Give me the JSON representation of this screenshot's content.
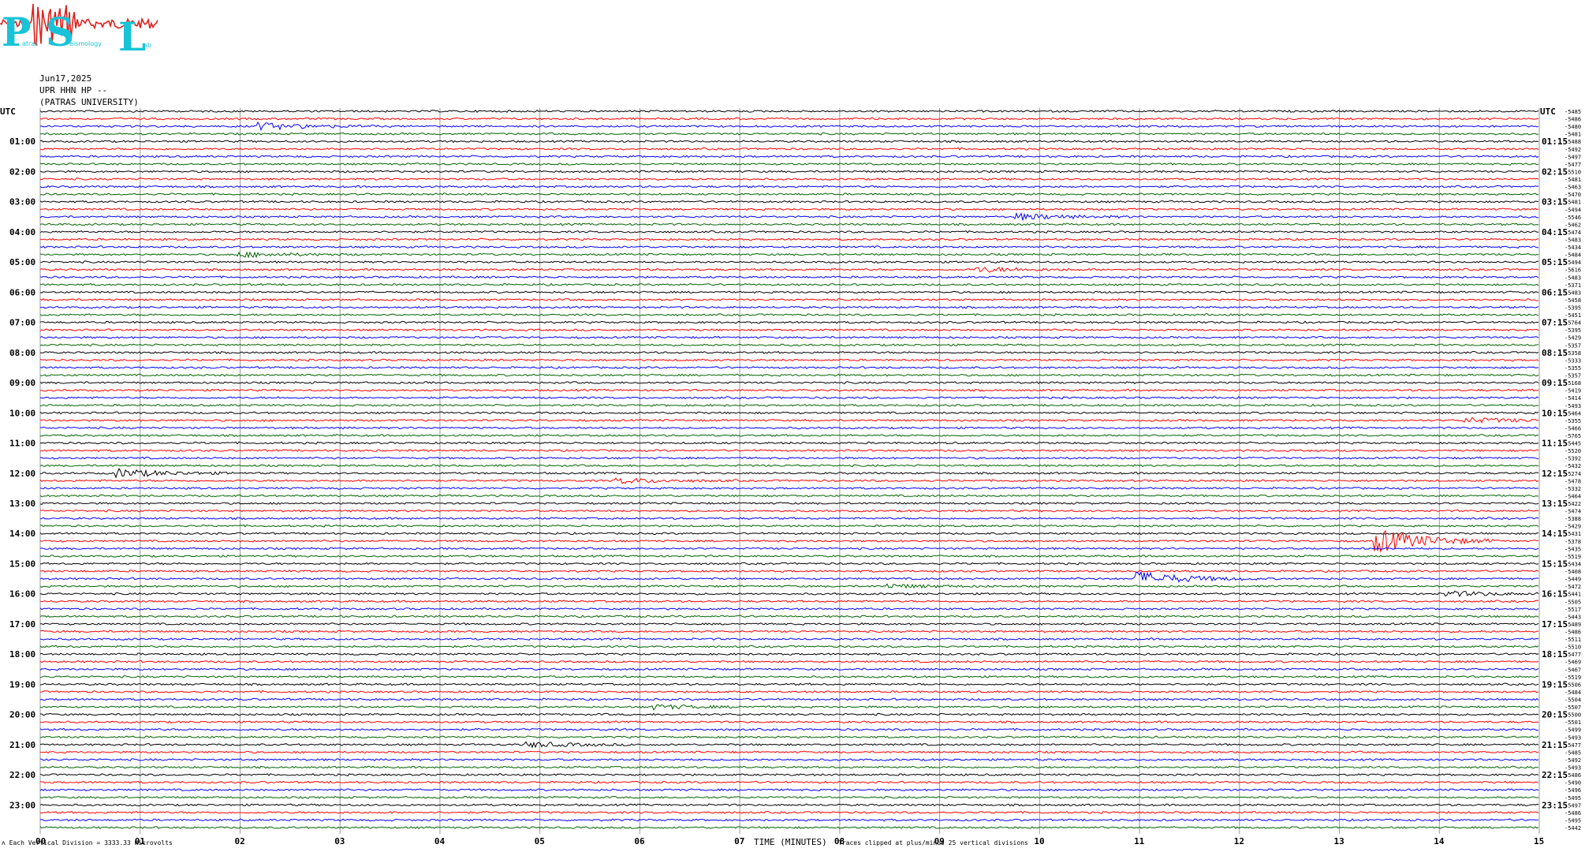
{
  "logo": {
    "letters": [
      "P",
      "S",
      "L"
    ],
    "small_words": [
      "atras",
      "eismology",
      "ab"
    ],
    "colors": {
      "letters": "#18c3d8",
      "trace": "#e0201c"
    }
  },
  "header": {
    "date": "Jun17,2025",
    "station": "UPR HHN HP --",
    "org": "(PATRAS UNIVERSITY)"
  },
  "footer": {
    "mark": "ʌ",
    "scale_note": "Each Vertical Division = 3333.33 microvolts",
    "xlabel": "TIME (MINUTES)",
    "clip_note": "Traces clipped at plus/minus 25 vertical divisions"
  },
  "chart_data": {
    "type": "line",
    "title": "",
    "xlabel": "TIME (MINUTES)",
    "xlim": [
      0,
      15
    ],
    "x_ticks": [
      "00",
      "01",
      "02",
      "03",
      "04",
      "05",
      "06",
      "07",
      "08",
      "09",
      "10",
      "11",
      "12",
      "13",
      "14",
      "15"
    ],
    "left_axis_title": "UTC",
    "right_axis_title": "UTC",
    "left_hour_labels": [
      "01:00",
      "02:00",
      "03:00",
      "04:00",
      "05:00",
      "06:00",
      "07:00",
      "08:00",
      "09:00",
      "10:00",
      "11:00",
      "12:00",
      "13:00",
      "14:00",
      "15:00",
      "16:00",
      "17:00",
      "18:00",
      "19:00",
      "20:00",
      "21:00",
      "22:00",
      "23:00"
    ],
    "right_hour_labels": [
      "01:15",
      "02:15",
      "03:15",
      "04:15",
      "05:15",
      "06:15",
      "07:15",
      "08:15",
      "09:15",
      "10:15",
      "11:15",
      "12:15",
      "13:15",
      "14:15",
      "15:15",
      "16:15",
      "17:15",
      "18:15",
      "19:15",
      "20:15",
      "21:15",
      "22:15",
      "23:15"
    ],
    "trace_color_cycle": [
      "#000000",
      "#ff0000",
      "#0000ff",
      "#006400"
    ],
    "trace_count": 96,
    "trace_offsets": [
      "-5485",
      "-5486",
      "-5480",
      "-5481",
      "-5488",
      "-5492",
      "-5497",
      "-5477",
      "-5510",
      "-5481",
      "-5463",
      "-5470",
      "-5481",
      "-5494",
      "-5546",
      "-5462",
      "-5474",
      "-5483",
      "-5434",
      "-5484",
      "-5494",
      "-5616",
      "-5483",
      "-5371",
      "-5483",
      "-5458",
      "-5395",
      "-5451",
      "-5764",
      "-5395",
      "-5429",
      "-5357",
      "-5358",
      "-5333",
      "-5355",
      "-5357",
      "-5168",
      "-5419",
      "-5414",
      "-5493",
      "-5464",
      "-5355",
      "-5466",
      "-5765",
      "-5445",
      "-5520",
      "-5392",
      "-5432",
      "-5274",
      "-5478",
      "-5332",
      "-5464",
      "-5422",
      "-5474",
      "-5388",
      "-5429",
      "-5431",
      "-5378",
      "-5435",
      "-5519",
      "-5434",
      "-5408",
      "-5449",
      "-5472",
      "-5441",
      "-5505",
      "-5517",
      "-5443",
      "-5489",
      "-5486",
      "-5511",
      "-5510",
      "-5477",
      "-5469",
      "-5467",
      "-5519",
      "-5506",
      "-5484",
      "-5504",
      "-5507",
      "-5500",
      "-5501",
      "-5499",
      "-5493",
      "-5477",
      "-5485",
      "-5492",
      "-5493",
      "-5486",
      "-5490",
      "-5496",
      "-5495",
      "-5497",
      "-5486",
      "-5495",
      "-5442"
    ],
    "events": [
      {
        "trace": 2,
        "minute": 2.2,
        "amplitude": 0.7
      },
      {
        "trace": 14,
        "minute": 9.8,
        "amplitude": 0.6
      },
      {
        "trace": 19,
        "minute": 2.0,
        "amplitude": 0.5
      },
      {
        "trace": 21,
        "minute": 9.4,
        "amplitude": 0.5
      },
      {
        "trace": 41,
        "minute": 14.3,
        "amplitude": 0.5
      },
      {
        "trace": 48,
        "minute": 0.8,
        "amplitude": 0.8
      },
      {
        "trace": 49,
        "minute": 5.8,
        "amplitude": 0.5
      },
      {
        "trace": 57,
        "minute": 13.4,
        "amplitude": 2.4
      },
      {
        "trace": 62,
        "minute": 11.0,
        "amplitude": 1.4
      },
      {
        "trace": 63,
        "minute": 8.5,
        "amplitude": 0.4
      },
      {
        "trace": 64,
        "minute": 14.1,
        "amplitude": 0.5
      },
      {
        "trace": 79,
        "minute": 6.1,
        "amplitude": 0.5
      },
      {
        "trace": 84,
        "minute": 4.9,
        "amplitude": 0.5
      }
    ]
  }
}
